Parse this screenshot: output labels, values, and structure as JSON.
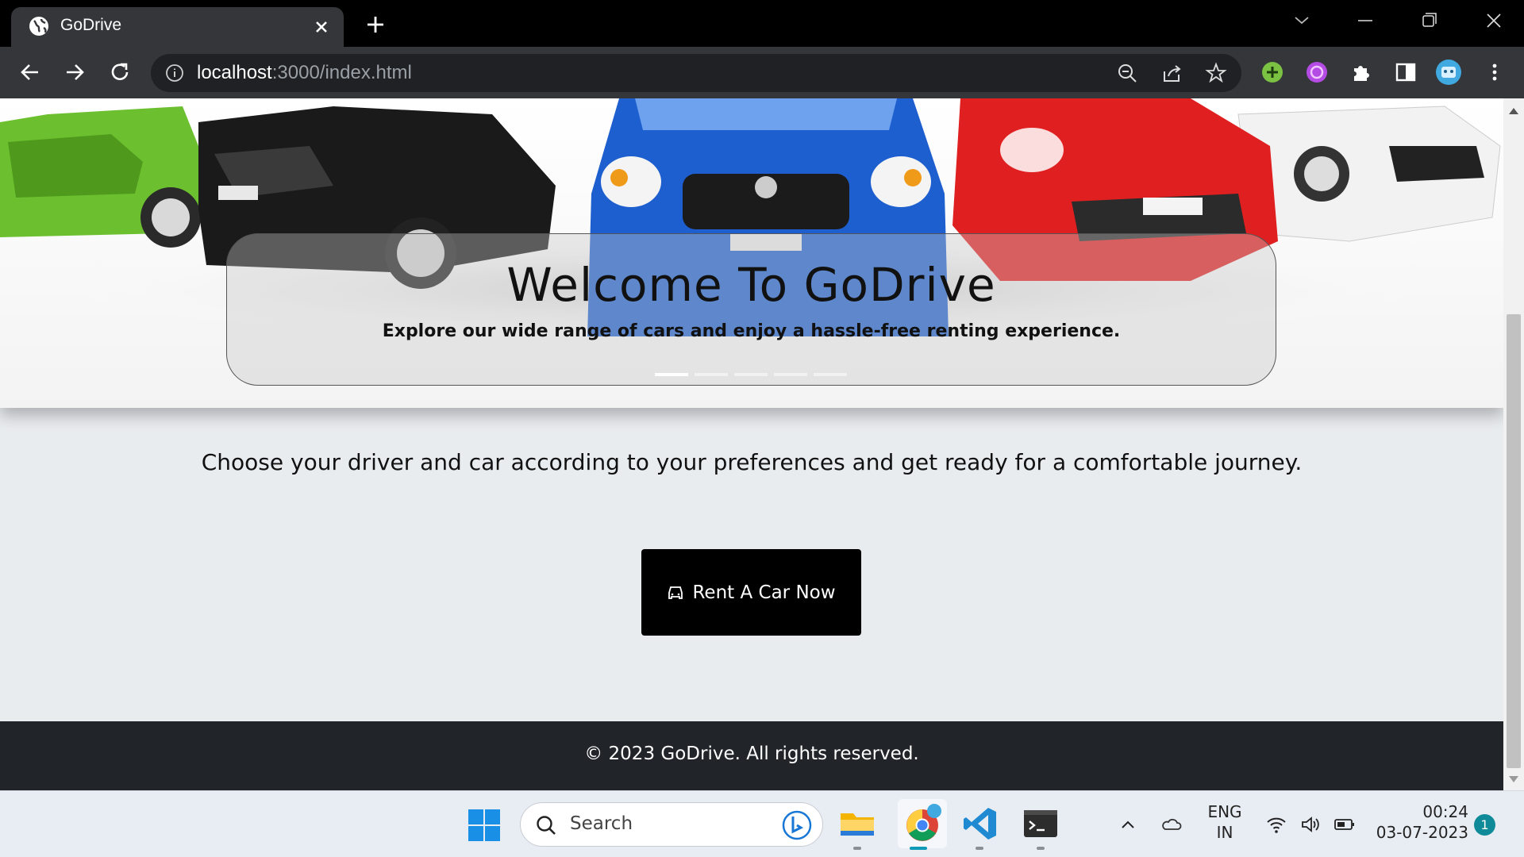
{
  "browser": {
    "tab": {
      "title": "GoDrive"
    },
    "address": {
      "host": "localhost",
      "path": ":3000/index.html"
    }
  },
  "page": {
    "hero": {
      "title": "Welcome To GoDrive",
      "subtitle": "Explore our wide range of cars and enjoy a hassle-free renting experience.",
      "slides_total": 5,
      "active_slide": 1
    },
    "tagline": "Choose your driver and car according to your preferences and get ready for a comfortable journey.",
    "cta": {
      "label": "Rent A Car Now",
      "icon": "car-icon"
    },
    "footer": {
      "text": "© 2023 GoDrive. All rights reserved."
    }
  },
  "taskbar": {
    "search_placeholder": "Search",
    "lang_line1": "ENG",
    "lang_line2": "IN",
    "time": "00:24",
    "date": "03-07-2023",
    "notification_count": "1"
  },
  "colors": {
    "footer_bg": "#212529",
    "page_bg": "#e9ecef",
    "cta_bg": "#000000",
    "browser_chrome": "#35363a"
  }
}
